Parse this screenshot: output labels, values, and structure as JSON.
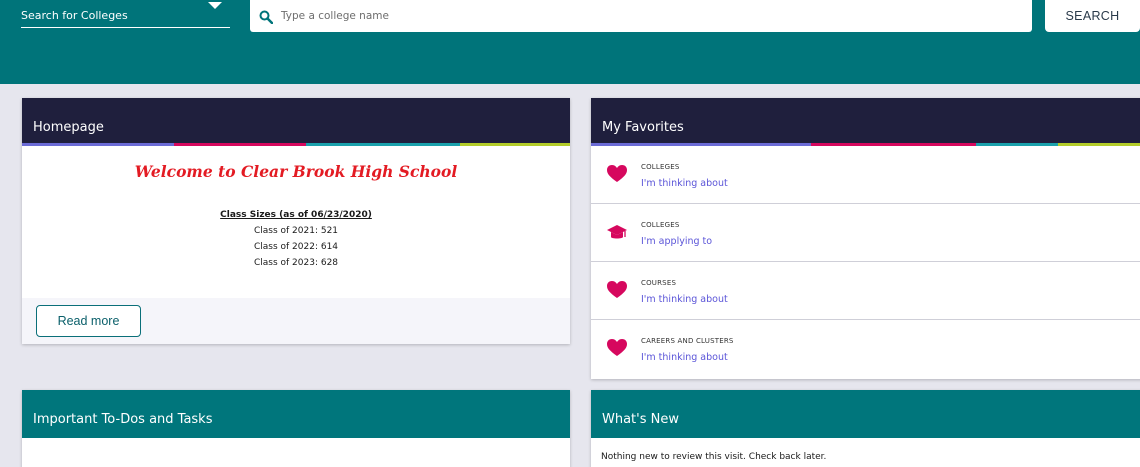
{
  "header": {
    "search_type": "Search for Colleges",
    "search_placeholder": "Type a college name",
    "search_button": "SEARCH"
  },
  "homepage": {
    "title": "Homepage",
    "welcome": "Welcome to Clear Brook High School",
    "sizes_title": "Class Sizes (as of 06/23/2020)",
    "class_lines": [
      "Class of 2021: 521",
      "Class of 2022: 614",
      "Class of 2023: 628"
    ],
    "read_more": "Read more"
  },
  "favorites": {
    "title": "My Favorites",
    "items": [
      {
        "category": "COLLEGES",
        "link": "I'm thinking about",
        "icon": "heart-icon"
      },
      {
        "category": "COLLEGES",
        "link": "I'm applying to",
        "icon": "graduation-cap-icon"
      },
      {
        "category": "COURSES",
        "link": "I'm thinking about",
        "icon": "heart-icon"
      },
      {
        "category": "CAREERS AND CLUSTERS",
        "link": "I'm thinking about",
        "icon": "heart-icon"
      }
    ]
  },
  "todos": {
    "title": "Important To-Dos and Tasks"
  },
  "whats_new": {
    "title": "What's New",
    "message": "Nothing new to review this visit. Check back later."
  },
  "colors": {
    "header_teal": "#00747a",
    "card_dark": "#1f1f3d",
    "welcome_red": "#e31b23",
    "link_purple": "#5b55d8",
    "heart_pink": "#d6085e",
    "stripe": [
      "#6b6bd6",
      "#d6085e",
      "#1aa1ac",
      "#b3cc2a"
    ]
  }
}
